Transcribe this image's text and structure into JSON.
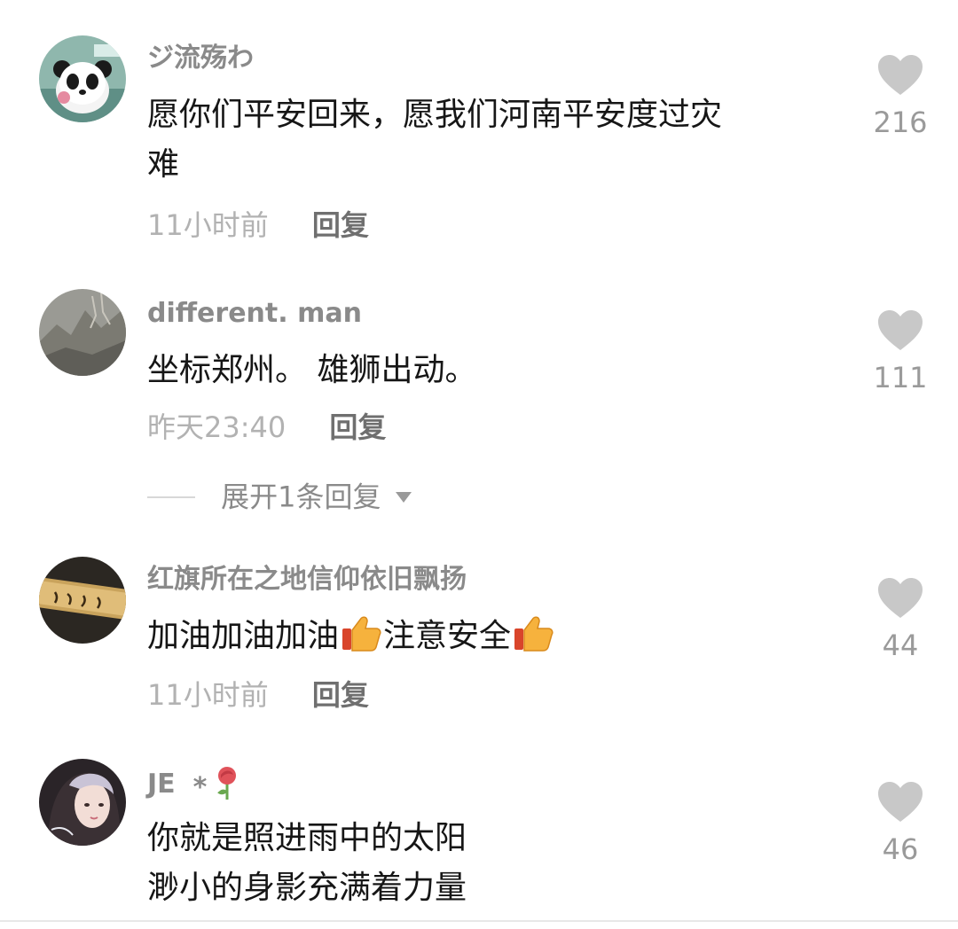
{
  "comments": [
    {
      "username": "ジ流殇わ",
      "text_line1": "愿你们平安回来，愿我们河南平安度过灾",
      "text_line2": "难",
      "time": "11小时前",
      "reply_label": "回复",
      "likes": "216",
      "avatar_icon": "panda-avatar-icon"
    },
    {
      "username": "different. man",
      "text_line1": "坐标郑州。 雄狮出动。",
      "time": "昨天23:40",
      "reply_label": "回复",
      "likes": "111",
      "avatar_icon": "rocky-landscape-avatar-icon",
      "expand_label": "展开1条回复"
    },
    {
      "username": "红旗所在之地信仰依旧飘扬",
      "text_part1": "加油加油加油",
      "text_part2": "注意安全",
      "time": "11小时前",
      "reply_label": "回复",
      "likes": "44",
      "avatar_icon": "calligraphy-plaque-avatar-icon",
      "emoji": "thumbs-up-icon"
    },
    {
      "username": "JE",
      "username_suffix": "*",
      "text_line1": "你就是照进雨中的太阳",
      "text_line2": "渺小的身影充满着力量",
      "likes": "46",
      "avatar_icon": "portrait-avatar-icon",
      "badge_icon": "rose-icon"
    }
  ],
  "colors": {
    "username": "#8a8a8a",
    "text": "#161616",
    "time": "#b2b2b2",
    "reply": "#6f6f6f",
    "heart": "#c8c8c8",
    "like_count": "#9a9a9a"
  }
}
